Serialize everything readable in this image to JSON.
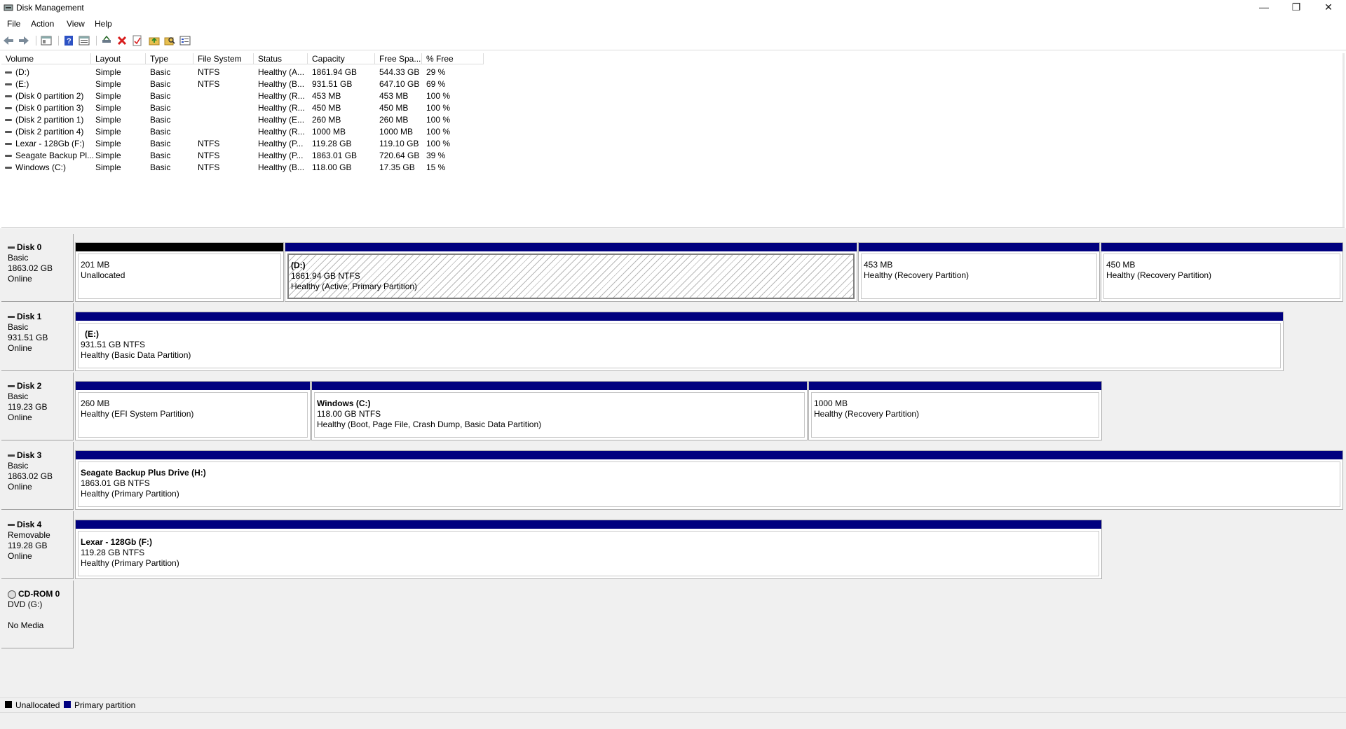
{
  "window": {
    "title": "Disk Management",
    "minimize_glyph": "—",
    "restore_glyph": "❐",
    "close_glyph": "✕"
  },
  "menu": [
    "File",
    "Action",
    "View",
    "Help"
  ],
  "toolbar_icons": [
    "back-icon",
    "forward-icon",
    "console-tree-icon",
    "help-icon",
    "properties-icon",
    "connect-icon",
    "delete-icon",
    "check-icon",
    "folder-up-icon",
    "search-icon",
    "list-icon"
  ],
  "volume_table": {
    "columns": [
      "Volume",
      "Layout",
      "Type",
      "File System",
      "Status",
      "Capacity",
      "Free Spa...",
      "% Free"
    ],
    "rows": [
      [
        "(D:)",
        "Simple",
        "Basic",
        "NTFS",
        "Healthy (A...",
        "1861.94 GB",
        "544.33 GB",
        "29 %"
      ],
      [
        "(E:)",
        "Simple",
        "Basic",
        "NTFS",
        "Healthy (B...",
        "931.51 GB",
        "647.10 GB",
        "69 %"
      ],
      [
        "(Disk 0 partition 2)",
        "Simple",
        "Basic",
        "",
        "Healthy (R...",
        "453 MB",
        "453 MB",
        "100 %"
      ],
      [
        "(Disk 0 partition 3)",
        "Simple",
        "Basic",
        "",
        "Healthy (R...",
        "450 MB",
        "450 MB",
        "100 %"
      ],
      [
        "(Disk 2 partition 1)",
        "Simple",
        "Basic",
        "",
        "Healthy (E...",
        "260 MB",
        "260 MB",
        "100 %"
      ],
      [
        "(Disk 2 partition 4)",
        "Simple",
        "Basic",
        "",
        "Healthy (R...",
        "1000 MB",
        "1000 MB",
        "100 %"
      ],
      [
        "Lexar - 128Gb (F:)",
        "Simple",
        "Basic",
        "NTFS",
        "Healthy (P...",
        "119.28 GB",
        "119.10 GB",
        "100 %"
      ],
      [
        "Seagate Backup Pl...",
        "Simple",
        "Basic",
        "NTFS",
        "Healthy (P...",
        "1863.01 GB",
        "720.64 GB",
        "39 %"
      ],
      [
        "Windows (C:)",
        "Simple",
        "Basic",
        "NTFS",
        "Healthy (B...",
        "118.00 GB",
        "17.35 GB",
        "15 %"
      ]
    ]
  },
  "disks": [
    {
      "name": "Disk 0",
      "type": "Basic",
      "size": "1863.02 GB",
      "status": "Online",
      "partitions": [
        {
          "name": "",
          "size": "201 MB",
          "status": "Unallocated",
          "kind": "unallocated"
        },
        {
          "name": "(D:)",
          "size": "1861.94 GB NTFS",
          "status": "Healthy (Active, Primary Partition)",
          "kind": "selected"
        },
        {
          "name": "",
          "size": "453 MB",
          "status": "Healthy (Recovery Partition)",
          "kind": "primary"
        },
        {
          "name": "",
          "size": "450 MB",
          "status": "Healthy (Recovery Partition)",
          "kind": "primary"
        }
      ]
    },
    {
      "name": "Disk 1",
      "type": "Basic",
      "size": "931.51 GB",
      "status": "Online",
      "partitions": [
        {
          "name": "(E:)",
          "size": "931.51 GB NTFS",
          "status": "Healthy (Basic Data Partition)",
          "kind": "primary"
        }
      ]
    },
    {
      "name": "Disk 2",
      "type": "Basic",
      "size": "119.23 GB",
      "status": "Online",
      "partitions": [
        {
          "name": "",
          "size": "260 MB",
          "status": "Healthy (EFI System Partition)",
          "kind": "primary"
        },
        {
          "name": "Windows  (C:)",
          "size": "118.00 GB NTFS",
          "status": "Healthy (Boot, Page File, Crash Dump, Basic Data Partition)",
          "kind": "primary"
        },
        {
          "name": "",
          "size": "1000 MB",
          "status": "Healthy (Recovery Partition)",
          "kind": "primary"
        }
      ]
    },
    {
      "name": "Disk 3",
      "type": "Basic",
      "size": "1863.02 GB",
      "status": "Online",
      "partitions": [
        {
          "name": "Seagate Backup Plus Drive  (H:)",
          "size": "1863.01 GB NTFS",
          "status": "Healthy (Primary Partition)",
          "kind": "primary"
        }
      ]
    },
    {
      "name": "Disk 4",
      "type": "Removable",
      "size": "119.28 GB",
      "status": "Online",
      "partitions": [
        {
          "name": "Lexar - 128Gb  (F:)",
          "size": "119.28 GB NTFS",
          "status": "Healthy (Primary Partition)",
          "kind": "primary"
        }
      ]
    },
    {
      "name": "CD-ROM 0",
      "type": "DVD (G:)",
      "size": "",
      "status": "No Media",
      "partitions": []
    }
  ],
  "legend": [
    {
      "label": "Unallocated",
      "color": "#000000"
    },
    {
      "label": "Primary partition",
      "color": "#00007f"
    }
  ]
}
